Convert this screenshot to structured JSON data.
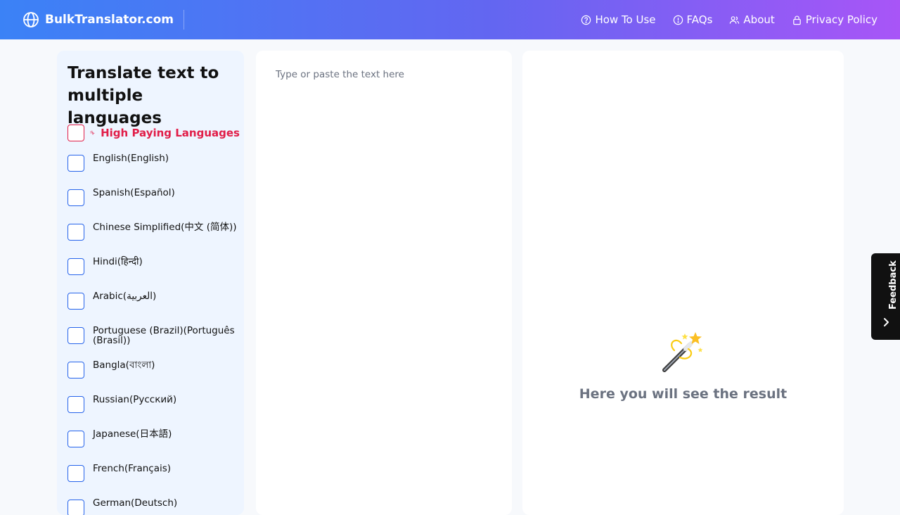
{
  "header": {
    "brand": "BulkTranslator.com",
    "nav": [
      {
        "label": "How To Use",
        "icon": "question-circle-icon"
      },
      {
        "label": "FAQs",
        "icon": "info-circle-icon"
      },
      {
        "label": "About",
        "icon": "users-icon"
      },
      {
        "label": "Privacy Policy",
        "icon": "lock-icon"
      }
    ]
  },
  "sidebar": {
    "title": "Translate text to multiple languages",
    "high_paying_label": "High Paying Languages",
    "languages": [
      "English(English)",
      "Spanish(Español)",
      "Chinese Simplified(中文 (简体))",
      "Hindi(हिन्दी)",
      "Arabic(العربية)",
      "Portuguese (Brazil)(Português (Brasil))",
      "Bangla(বাংলা)",
      "Russian(Русский)",
      "Japanese(日本語)",
      "French(Français)",
      "German(Deutsch)"
    ]
  },
  "input": {
    "placeholder": "Type or paste the text here"
  },
  "result": {
    "empty_text": "Here you will see the result"
  },
  "feedback": {
    "label": "Feedback"
  },
  "colors": {
    "accent": "#3b82f6",
    "gradient_end": "#a855f7",
    "high_paying": "#e11d48"
  }
}
